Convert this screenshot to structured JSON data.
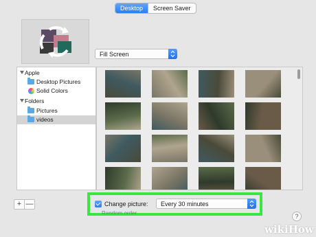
{
  "tabs": [
    {
      "label": "Desktop",
      "active": true
    },
    {
      "label": "Screen Saver",
      "active": false
    }
  ],
  "scaling_popup": {
    "value": "Fill Screen"
  },
  "sidebar": {
    "apple_group": "Apple",
    "apple_items": [
      "Desktop Pictures",
      "Solid Colors"
    ],
    "folders_group": "Folders",
    "folder_items": [
      "Pictures",
      "videos"
    ],
    "selected": "videos"
  },
  "grid": {
    "rows": 4,
    "columns": 4,
    "thumbnail_palette": [
      "#4a4a3a",
      "#7a7565",
      "#3f5a60",
      "#9a8f7a",
      "#2f3a2b",
      "#b0a58e",
      "#5a6b4a",
      "#6a5a48"
    ]
  },
  "list_controls": {
    "add": "+",
    "remove": "—"
  },
  "change_picture": {
    "label": "Change picture:",
    "checked": true,
    "interval_value": "Every 30 minutes"
  },
  "partial_label": "Random order",
  "help": "?",
  "watermark": {
    "prefix": "wiki",
    "suffix": "How"
  },
  "colors": {
    "accent": "#2a7df5",
    "highlight": "#3be73f",
    "background": "#e6e6e6"
  }
}
